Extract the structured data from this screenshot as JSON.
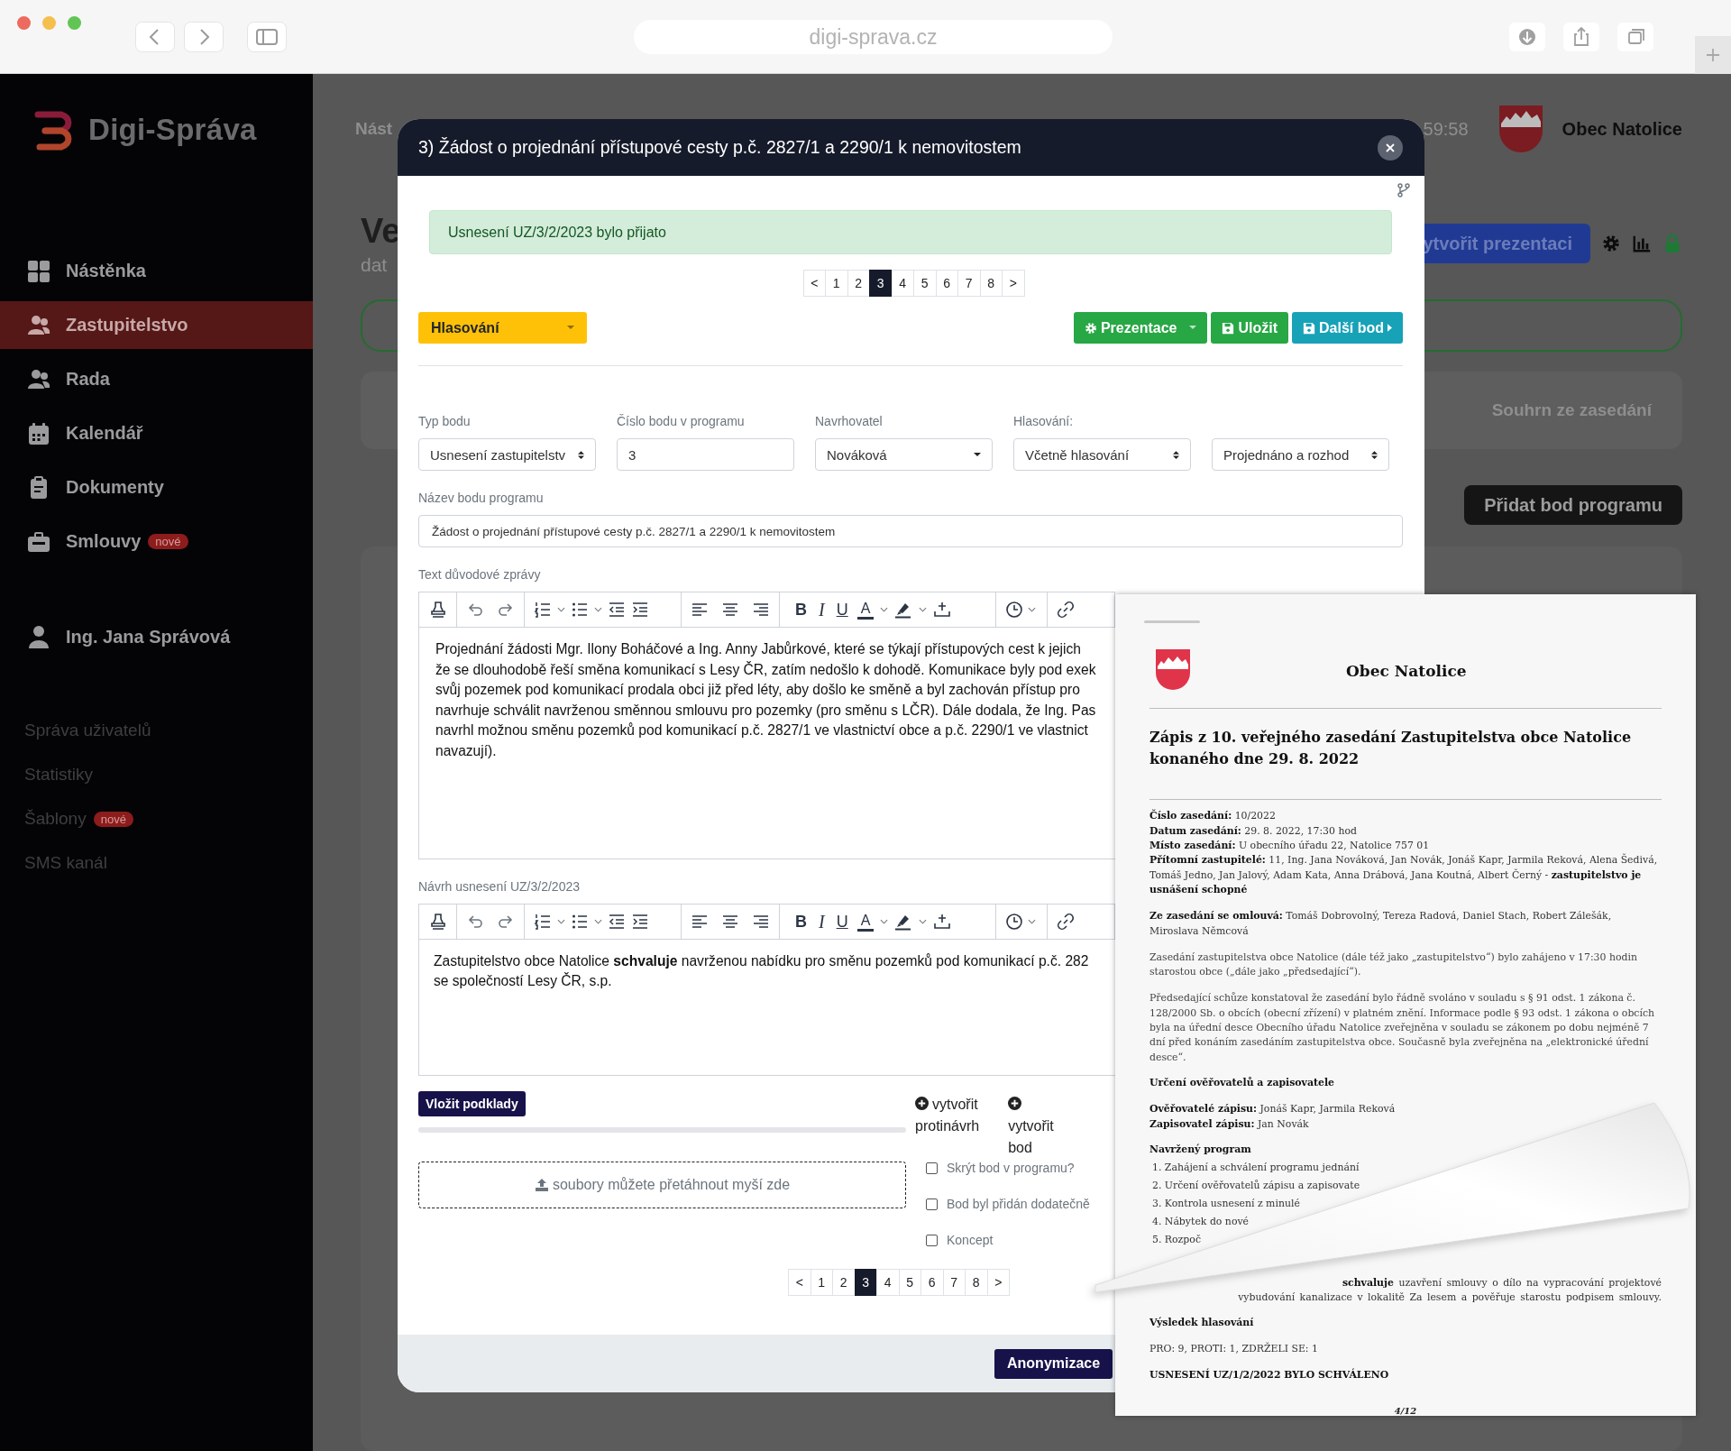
{
  "browser": {
    "address": "digi-sprava.cz"
  },
  "sidebar": {
    "brand": "Digi-Správa",
    "items": [
      {
        "label": "Nástěnka",
        "selected": false
      },
      {
        "label": "Zastupitelstvo",
        "selected": true
      },
      {
        "label": "Rada",
        "selected": false
      },
      {
        "label": "Kalendář",
        "selected": false
      },
      {
        "label": "Dokumenty",
        "selected": false
      },
      {
        "label": "Smlouvy",
        "badge": "nové",
        "selected": false
      }
    ],
    "user": "Ing. Jana Správová",
    "links": [
      {
        "label": "Správa uživatelů"
      },
      {
        "label": "Statistiky"
      },
      {
        "label": "Šablony",
        "badge": "nové"
      },
      {
        "label": "SMS kanál"
      }
    ]
  },
  "background_page": {
    "breadcrumb": "Nást",
    "clock": "59:58",
    "municipality": "Obec Natolice",
    "title": "Ve",
    "subtitle": "dat",
    "create_presentation": "ytvořit prezentaci",
    "summary_tab": "Souhrn ze zasedání",
    "add_item": "Přidat bod programu"
  },
  "modal": {
    "title": "3) Žádost o projednání přístupové cesty p.č. 2827/1 a 2290/1 k nemovitostem",
    "alert": "Usnesení UZ/3/2/2023 bylo přijato",
    "pagination_top": [
      {
        "label": "<",
        "selected": false
      },
      {
        "label": "1",
        "selected": false
      },
      {
        "label": "2",
        "selected": false
      },
      {
        "label": "3",
        "selected": true
      },
      {
        "label": "4",
        "selected": false
      },
      {
        "label": "5",
        "selected": false
      },
      {
        "label": "6",
        "selected": false
      },
      {
        "label": "7",
        "selected": false
      },
      {
        "label": "8",
        "selected": false
      },
      {
        "label": ">",
        "selected": false
      }
    ],
    "voting_dropdown": "Hlasování",
    "actions": [
      {
        "label": "Prezentace",
        "kind": "dropdown"
      },
      {
        "label": "Uložit",
        "kind": "save"
      },
      {
        "label": "Další bod",
        "kind": "next"
      }
    ],
    "fields": [
      {
        "label": "Typ bodu",
        "value": "Usnesení zastupitelstv",
        "kind": "spinner"
      },
      {
        "label": "Číslo bodu v programu",
        "value": "3",
        "kind": "input"
      },
      {
        "label": "Navrhovatel",
        "value": "Nováková",
        "kind": "dropdown"
      },
      {
        "label": "Hlasování:",
        "value": "Včetně hlasování",
        "kind": "spinner"
      },
      {
        "value": "Projednáno a rozhod",
        "kind": "spinner"
      }
    ],
    "name_field": {
      "label": "Název bodu programu",
      "value": "Žádost o projednání přístupové cesty p.č. 2827/1 a 2290/1 k nemovitostem"
    },
    "editors": [
      {
        "label": "Text důvodové zprávy",
        "bold": "B",
        "italic": "I",
        "underline": "U",
        "text_color": "A",
        "lines": [
          "Projednání žádosti Mgr. Ilony Boháčové a Ing. Anny Jabůrkové, které se týkají přístupových cest k jejich",
          "že se dlouhodobě řeší směna komunikací s Lesy ČR, zatím nedošlo k dohodě. Komunikace byly pod exek",
          "svůj pozemek pod komunikací prodala obci již před léty, aby došlo ke směně a byl zachován přístup pro",
          "navrhuje schválit navrženou směnnou smlouvu pro pozemky (pro směnu s LČR). Dále dodala, že Ing. Pas",
          "navrhl možnou směnu pozemků pod komunikací p.č. 2827/1 ve vlastnictví obce a p.č. 2290/1 ve vlastnict",
          "navazují)."
        ]
      },
      {
        "label": "Návrh usnesení UZ/3/2/2023",
        "bold": "B",
        "italic": "I",
        "underline": "U",
        "text_color": "A",
        "lines": [
          "Zastupitelstvo obce Natolice **schvaluje** navrženou nabídku pro směnu pozemků pod komunikací p.č. 282",
          "se společností Lesy ČR, s.p."
        ]
      }
    ],
    "upload_button": "Vložit podklady",
    "progress": {
      "level": 0
    },
    "create_links": [
      "vytvořit protinávrh",
      "vytvořit bod"
    ],
    "dropzone": "soubory můžete přetáhnout myší zde",
    "checkboxes": [
      {
        "label": "Skrýt bod v programu?",
        "checked": false
      },
      {
        "label": "Bod byl přidán dodatečně",
        "checked": false
      },
      {
        "label": "Koncept",
        "checked": false
      }
    ],
    "pagination_bottom": [
      {
        "label": "<",
        "selected": false
      },
      {
        "label": "1",
        "selected": false
      },
      {
        "label": "2",
        "selected": false
      },
      {
        "label": "3",
        "selected": true
      },
      {
        "label": "4",
        "selected": false
      },
      {
        "label": "5",
        "selected": false
      },
      {
        "label": "6",
        "selected": false
      },
      {
        "label": "7",
        "selected": false
      },
      {
        "label": "8",
        "selected": false
      },
      {
        "label": ">",
        "selected": false
      }
    ],
    "footer_button": "Anonymizace"
  },
  "document": {
    "heading": "Obec Natolice",
    "title": "Zápis z 10. veřejného zasedání Zastupitelstva obce Natolice konaného dne 29. 8. 2022",
    "blocks": [
      {
        "kind": "lines",
        "lines": [
          "**Číslo zasedání:** 10/2022",
          "**Datum zasedání:** 29. 8. 2022, 17:30 hod",
          "**Místo zasedání:** U obecního úřadu 22, Natolice 757 01",
          "**Přítomní zastupitelé:** 11, Ing. Jana Nováková, Jan Novák, Jonáš Kapr, Jarmila Reková, Alena Šedivá, Tomáš Jedno, Jan Jalový, Adam Kata, Anna Drábová, Jana Koutná, Albert Černý - **zastupitelstvo je usnášení schopné**"
        ]
      },
      {
        "kind": "lines",
        "lines": [
          "**Ze zasedání se omlouvá:** Tomáš Dobrovolný, Tereza Radová, Daniel Stach, Robert Zálešák, Miroslava Němcová"
        ]
      },
      {
        "kind": "para",
        "text": "Zasedání zastupitelstva obce Natolice (dále též jako „zastupitelstvo“) bylo zahájeno v 17:30 hodin starostou obce („dále jako „předsedající“)."
      },
      {
        "kind": "para",
        "text": "Předsedající schůze konstatoval že zasedání bylo řádně svoláno v souladu s § 91 odst. 1 zákona č. 128/2000 Sb. o obcích (obecní zřízení) v platném znění. Informace podle § 93 odst. 1 zákona o obcích byla na úřední desce Obecního úřadu Natolice zveřejněna v souladu se zákonem po dobu nejméně 7 dní před konáním zasedáním zastupitelstva obce. Současně byla zveřejněna na „elektronické úřední desce“."
      },
      {
        "kind": "heading",
        "text": "Určení ověřovatelů a zapisovatele"
      },
      {
        "kind": "lines",
        "lines": [
          "**Ověřovatelé zápisu:** Jonáš Kapr, Jarmila Reková",
          "**Zapisovatel zápisu:** Jan Novák"
        ]
      },
      {
        "kind": "heading",
        "text": "Navržený program"
      },
      {
        "kind": "list",
        "items": [
          "1. Zahájení a schválení programu jednání",
          "2. Určení ověřovatelů zápisu a zapisovate",
          "3. Kontrola usnesení z minulé",
          "4. Nábytek do nové",
          "5. Rozpoč"
        ]
      },
      {
        "kind": "curled",
        "lines": [
          "**schvaluje** uzavření smlouvy o dílo na vypracování projektové",
          "vybudování kanalizace v lokalitě Za lesem a pověřuje starostu podpisem smlouvy."
        ]
      },
      {
        "kind": "heading",
        "text": "Výsledek hlasování"
      },
      {
        "kind": "lines",
        "lines": [
          "PRO: 9, PROTI: 1, ZDRŽELI SE: 1"
        ]
      },
      {
        "kind": "heading",
        "text": "USNESENÍ UZ/1/2/2022 BYLO SCHVÁLENO"
      }
    ],
    "page_number": "4/12"
  }
}
